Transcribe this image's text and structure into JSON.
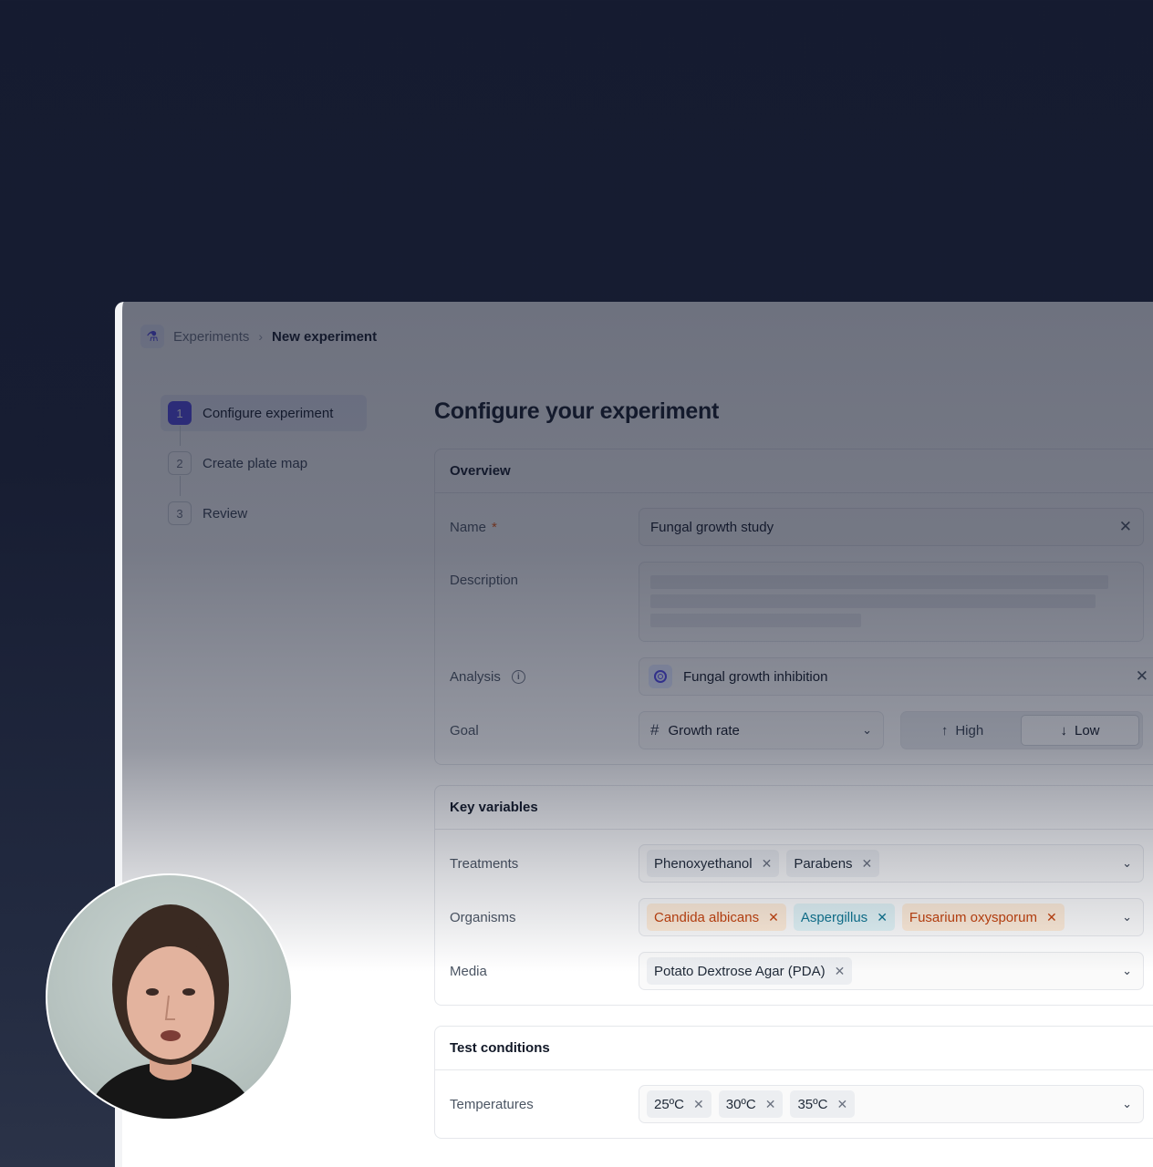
{
  "breadcrumb": {
    "icon": "flask-icon",
    "root": "Experiments",
    "current": "New experiment"
  },
  "steps": [
    {
      "num": "1",
      "label": "Configure experiment",
      "active": true
    },
    {
      "num": "2",
      "label": "Create plate map",
      "active": false
    },
    {
      "num": "3",
      "label": "Review",
      "active": false
    }
  ],
  "page_title": "Configure your experiment",
  "overview": {
    "title": "Overview",
    "name_label": "Name",
    "required_mark": "*",
    "name_value": "Fungal growth study",
    "description_label": "Description",
    "analysis_label": "Analysis",
    "analysis_value": "Fungal growth inhibition",
    "goal_label": "Goal",
    "goal_metric": "Growth rate",
    "goal_high": "High",
    "goal_low": "Low",
    "goal_selected": "Low"
  },
  "key_variables": {
    "title": "Key variables",
    "treatments_label": "Treatments",
    "treatments": [
      "Phenoxyethanol",
      "Parabens"
    ],
    "organisms_label": "Organisms",
    "organisms": [
      "Candida albicans",
      "Aspergillus",
      "Fusarium oxysporum"
    ],
    "media_label": "Media",
    "media": [
      "Potato Dextrose Agar (PDA)"
    ]
  },
  "test_conditions": {
    "title": "Test conditions",
    "temperatures_label": "Temperatures",
    "temperatures": [
      "25ºC",
      "30ºC",
      "35ºC"
    ]
  },
  "colors": {
    "accent": "#4f46e5",
    "tag_orange": "#c2410c",
    "tag_teal": "#0e7490",
    "backdrop": "#151b30"
  }
}
